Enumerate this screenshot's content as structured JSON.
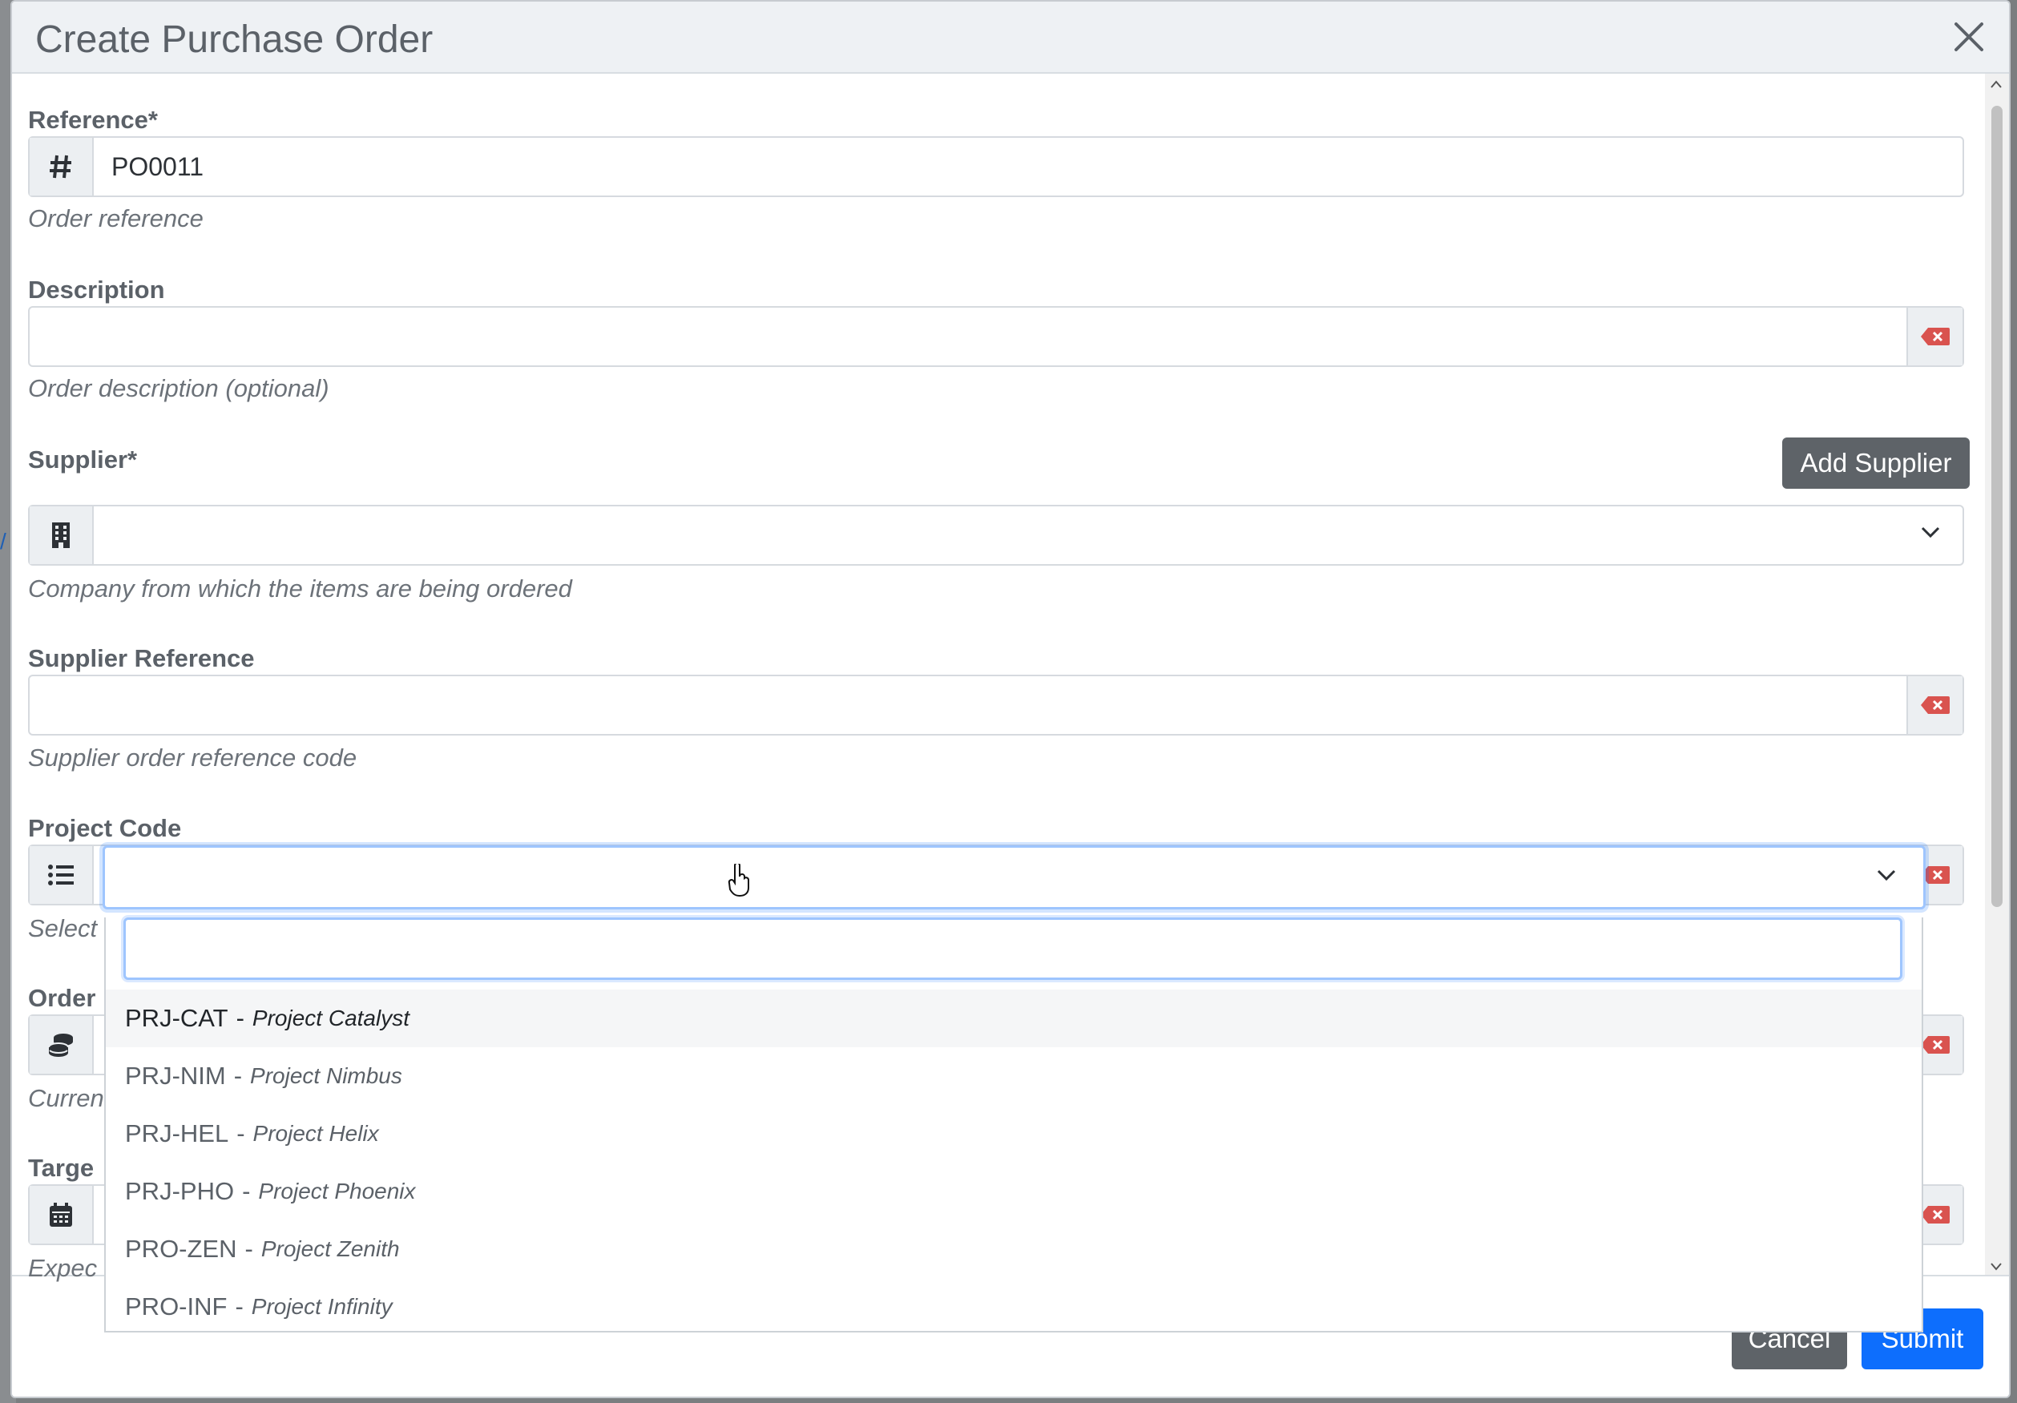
{
  "dialog": {
    "title": "Create Purchase Order",
    "close_icon": "close-icon"
  },
  "fields": {
    "reference": {
      "label": "Reference*",
      "value": "PO0011",
      "help": "Order reference",
      "icon": "hash-icon"
    },
    "description": {
      "label": "Description",
      "value": "",
      "help": "Order description (optional)",
      "clear_icon": "clear-icon"
    },
    "supplier": {
      "label": "Supplier*",
      "add_button": "Add Supplier",
      "value": "",
      "help": "Company from which the items are being ordered",
      "icon": "building-icon"
    },
    "supplier_reference": {
      "label": "Supplier Reference",
      "value": "",
      "help": "Supplier order reference code",
      "clear_icon": "clear-icon"
    },
    "project_code": {
      "label": "Project Code",
      "value": "",
      "help_partial": "Select",
      "icon": "list-icon"
    },
    "order_currency": {
      "label_partial": "Order",
      "help_partial": "Curren",
      "icon": "coins-icon"
    },
    "target_date": {
      "label_partial": "Targe",
      "help_partial": "Expec",
      "icon": "calendar-icon"
    }
  },
  "dropdown": {
    "search_value": "",
    "options": [
      {
        "code": "PRJ-CAT",
        "name": "Project Catalyst",
        "active": true
      },
      {
        "code": "PRJ-NIM",
        "name": "Project Nimbus",
        "active": false
      },
      {
        "code": "PRJ-HEL",
        "name": "Project Helix",
        "active": false
      },
      {
        "code": "PRJ-PHO",
        "name": "Project Phoenix",
        "active": false
      },
      {
        "code": "PRO-ZEN",
        "name": "Project Zenith",
        "active": false
      },
      {
        "code": "PRO-INF",
        "name": "Project Infinity",
        "active": false
      }
    ]
  },
  "footer": {
    "cancel": "Cancel",
    "submit": "Submit"
  },
  "colors": {
    "primary": "#0d6efd",
    "secondary": "#5e6368",
    "danger": "#d9534f"
  }
}
